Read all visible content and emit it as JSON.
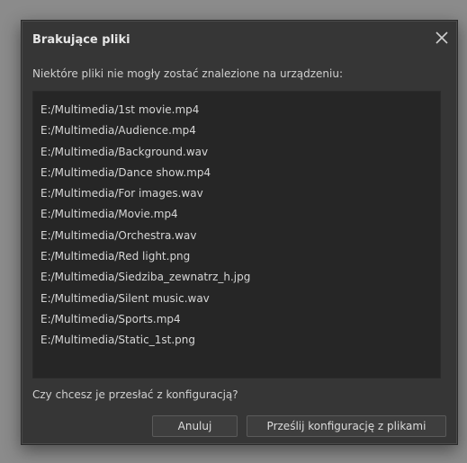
{
  "dialog": {
    "title": "Brakujące pliki",
    "message": "Niektóre pliki nie mogły zostać znalezione na urządzeniu:",
    "files": [
      "E:/Multimedia/1st movie.mp4",
      "E:/Multimedia/Audience.mp4",
      "E:/Multimedia/Background.wav",
      "E:/Multimedia/Dance show.mp4",
      "E:/Multimedia/For images.wav",
      "E:/Multimedia/Movie.mp4",
      "E:/Multimedia/Orchestra.wav",
      "E:/Multimedia/Red light.png",
      "E:/Multimedia/Siedziba_zewnatrz_h.jpg",
      "E:/Multimedia/Silent music.wav",
      "E:/Multimedia/Sports.mp4",
      "E:/Multimedia/Static_1st.png"
    ],
    "question": "Czy chcesz je przesłać z konfiguracją?",
    "cancel_label": "Anuluj",
    "send_label": "Prześlij konfigurację z plikami",
    "close_icon": "close-icon"
  },
  "colors": {
    "dialog_bg": "#363636",
    "list_bg": "#262626",
    "text": "#d6d6d6",
    "button_border": "#5a5a5a"
  }
}
